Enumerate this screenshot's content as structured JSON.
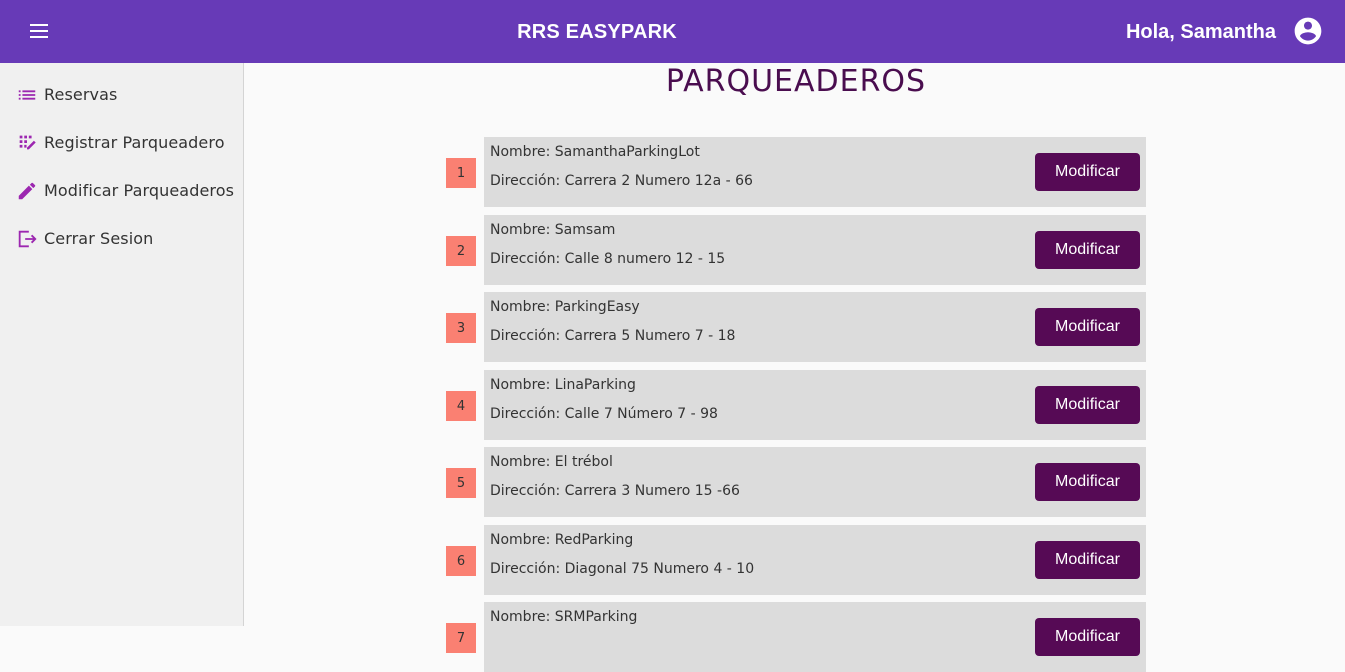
{
  "header": {
    "title": "RRS EASYPARK",
    "greeting": "Hola, Samantha"
  },
  "sidebar": {
    "items": [
      {
        "label": "Reservas",
        "icon": "list-icon"
      },
      {
        "label": "Registrar Parqueadero",
        "icon": "grid-edit-icon"
      },
      {
        "label": "Modificar Parqueaderos",
        "icon": "pencil-icon"
      },
      {
        "label": "Cerrar Sesion",
        "icon": "logout-icon"
      }
    ]
  },
  "main": {
    "title": "PARQUEADEROS",
    "button_label": "Modificar",
    "lots": [
      {
        "number": "1",
        "name": "Nombre: SamanthaParkingLot",
        "address": "Dirección: Carrera 2 Numero 12a - 66"
      },
      {
        "number": "2",
        "name": "Nombre: Samsam",
        "address": "Dirección: Calle 8 numero 12 - 15"
      },
      {
        "number": "3",
        "name": "Nombre: ParkingEasy",
        "address": "Dirección: Carrera 5 Numero 7 - 18"
      },
      {
        "number": "4",
        "name": "Nombre: LinaParking",
        "address": "Dirección: Calle 7 Número 7 - 98"
      },
      {
        "number": "5",
        "name": "Nombre: El trébol",
        "address": "Dirección: Carrera 3 Numero 15 -66"
      },
      {
        "number": "6",
        "name": "Nombre: RedParking",
        "address": "Dirección: Diagonal 75 Numero 4 - 10"
      },
      {
        "number": "7",
        "name": "Nombre: SRMParking",
        "address": ""
      }
    ]
  },
  "colors": {
    "primary": "#673ab7",
    "accent_button": "#560a55",
    "number_badge": "#fa8072",
    "card_bg": "#dcdcdc",
    "sidebar_icon": "#9c27b0",
    "title": "#4a0d4f"
  }
}
